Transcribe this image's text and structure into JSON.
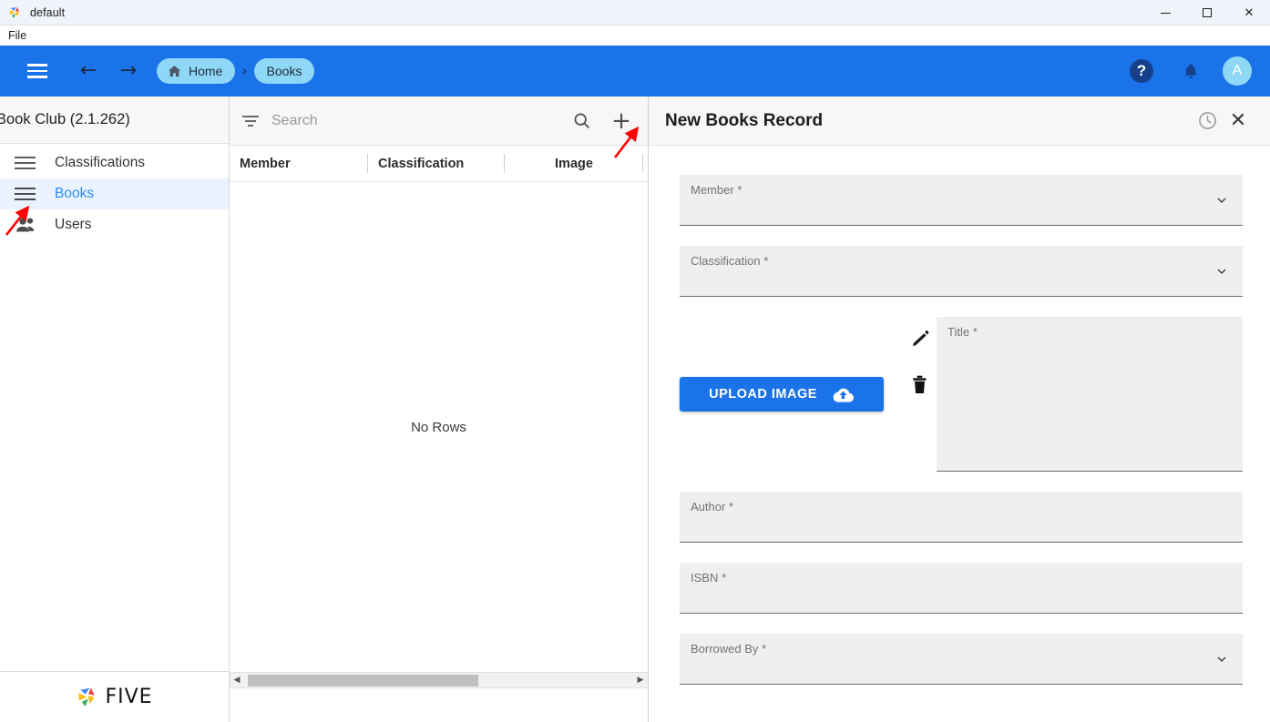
{
  "window": {
    "title": "default",
    "app_icon": "five-logo-icon",
    "controls": {
      "minimize": "minimize-icon",
      "maximize": "maximize-icon",
      "close": "close-icon"
    }
  },
  "menubar": {
    "items": [
      {
        "label": "File"
      }
    ]
  },
  "appbar": {
    "menu_icon": "hamburger-icon",
    "back_icon": "arrow-left-icon",
    "forward_icon": "arrow-right-icon",
    "breadcrumbs": [
      {
        "label": "Home",
        "icon": "home-icon"
      },
      {
        "label": "Books",
        "icon": ""
      }
    ],
    "separator": "›",
    "help_label": "?",
    "notification_icon": "bell-icon",
    "avatar_initial": "A",
    "color": "#1a73e8",
    "chip_color": "#8ed7f7"
  },
  "sidebar": {
    "title": "Book Club (2.1.262)",
    "items": [
      {
        "label": "Classifications",
        "icon": "list-icon",
        "active": false
      },
      {
        "label": "Books",
        "icon": "list-icon",
        "active": true
      },
      {
        "label": "Users",
        "icon": "people-icon",
        "active": false
      }
    ],
    "footer_logo": "FIVE"
  },
  "list_panel": {
    "filter_icon": "filter-icon",
    "search_placeholder": "Search",
    "search_value": "",
    "search_icon": "search-icon",
    "add_icon": "plus-icon",
    "columns": [
      "Member",
      "Classification",
      "Image"
    ],
    "empty_message": "No Rows",
    "scrollbar": {
      "left_arrow": "◀",
      "right_arrow": "▶"
    }
  },
  "detail_panel": {
    "title": "New Books Record",
    "history_icon": "clock-icon",
    "close_icon": "close-icon",
    "fields": [
      {
        "label": "Member *",
        "type": "select",
        "value": ""
      },
      {
        "label": "Classification *",
        "type": "select",
        "value": ""
      },
      {
        "label": "Title *",
        "type": "textarea",
        "value": ""
      },
      {
        "label": "Author *",
        "type": "text",
        "value": ""
      },
      {
        "label": "ISBN *",
        "type": "text",
        "value": ""
      },
      {
        "label": "Borrowed By *",
        "type": "select",
        "value": ""
      }
    ],
    "upload_button": {
      "label": "UPLOAD IMAGE",
      "icon": "cloud-upload-icon"
    },
    "edit_icon": "pencil-icon",
    "delete_icon": "trash-icon"
  },
  "annotations": [
    {
      "name": "arrow-to-add-button",
      "color": "#ff0000"
    },
    {
      "name": "arrow-to-books-nav-item",
      "color": "#ff0000"
    }
  ]
}
